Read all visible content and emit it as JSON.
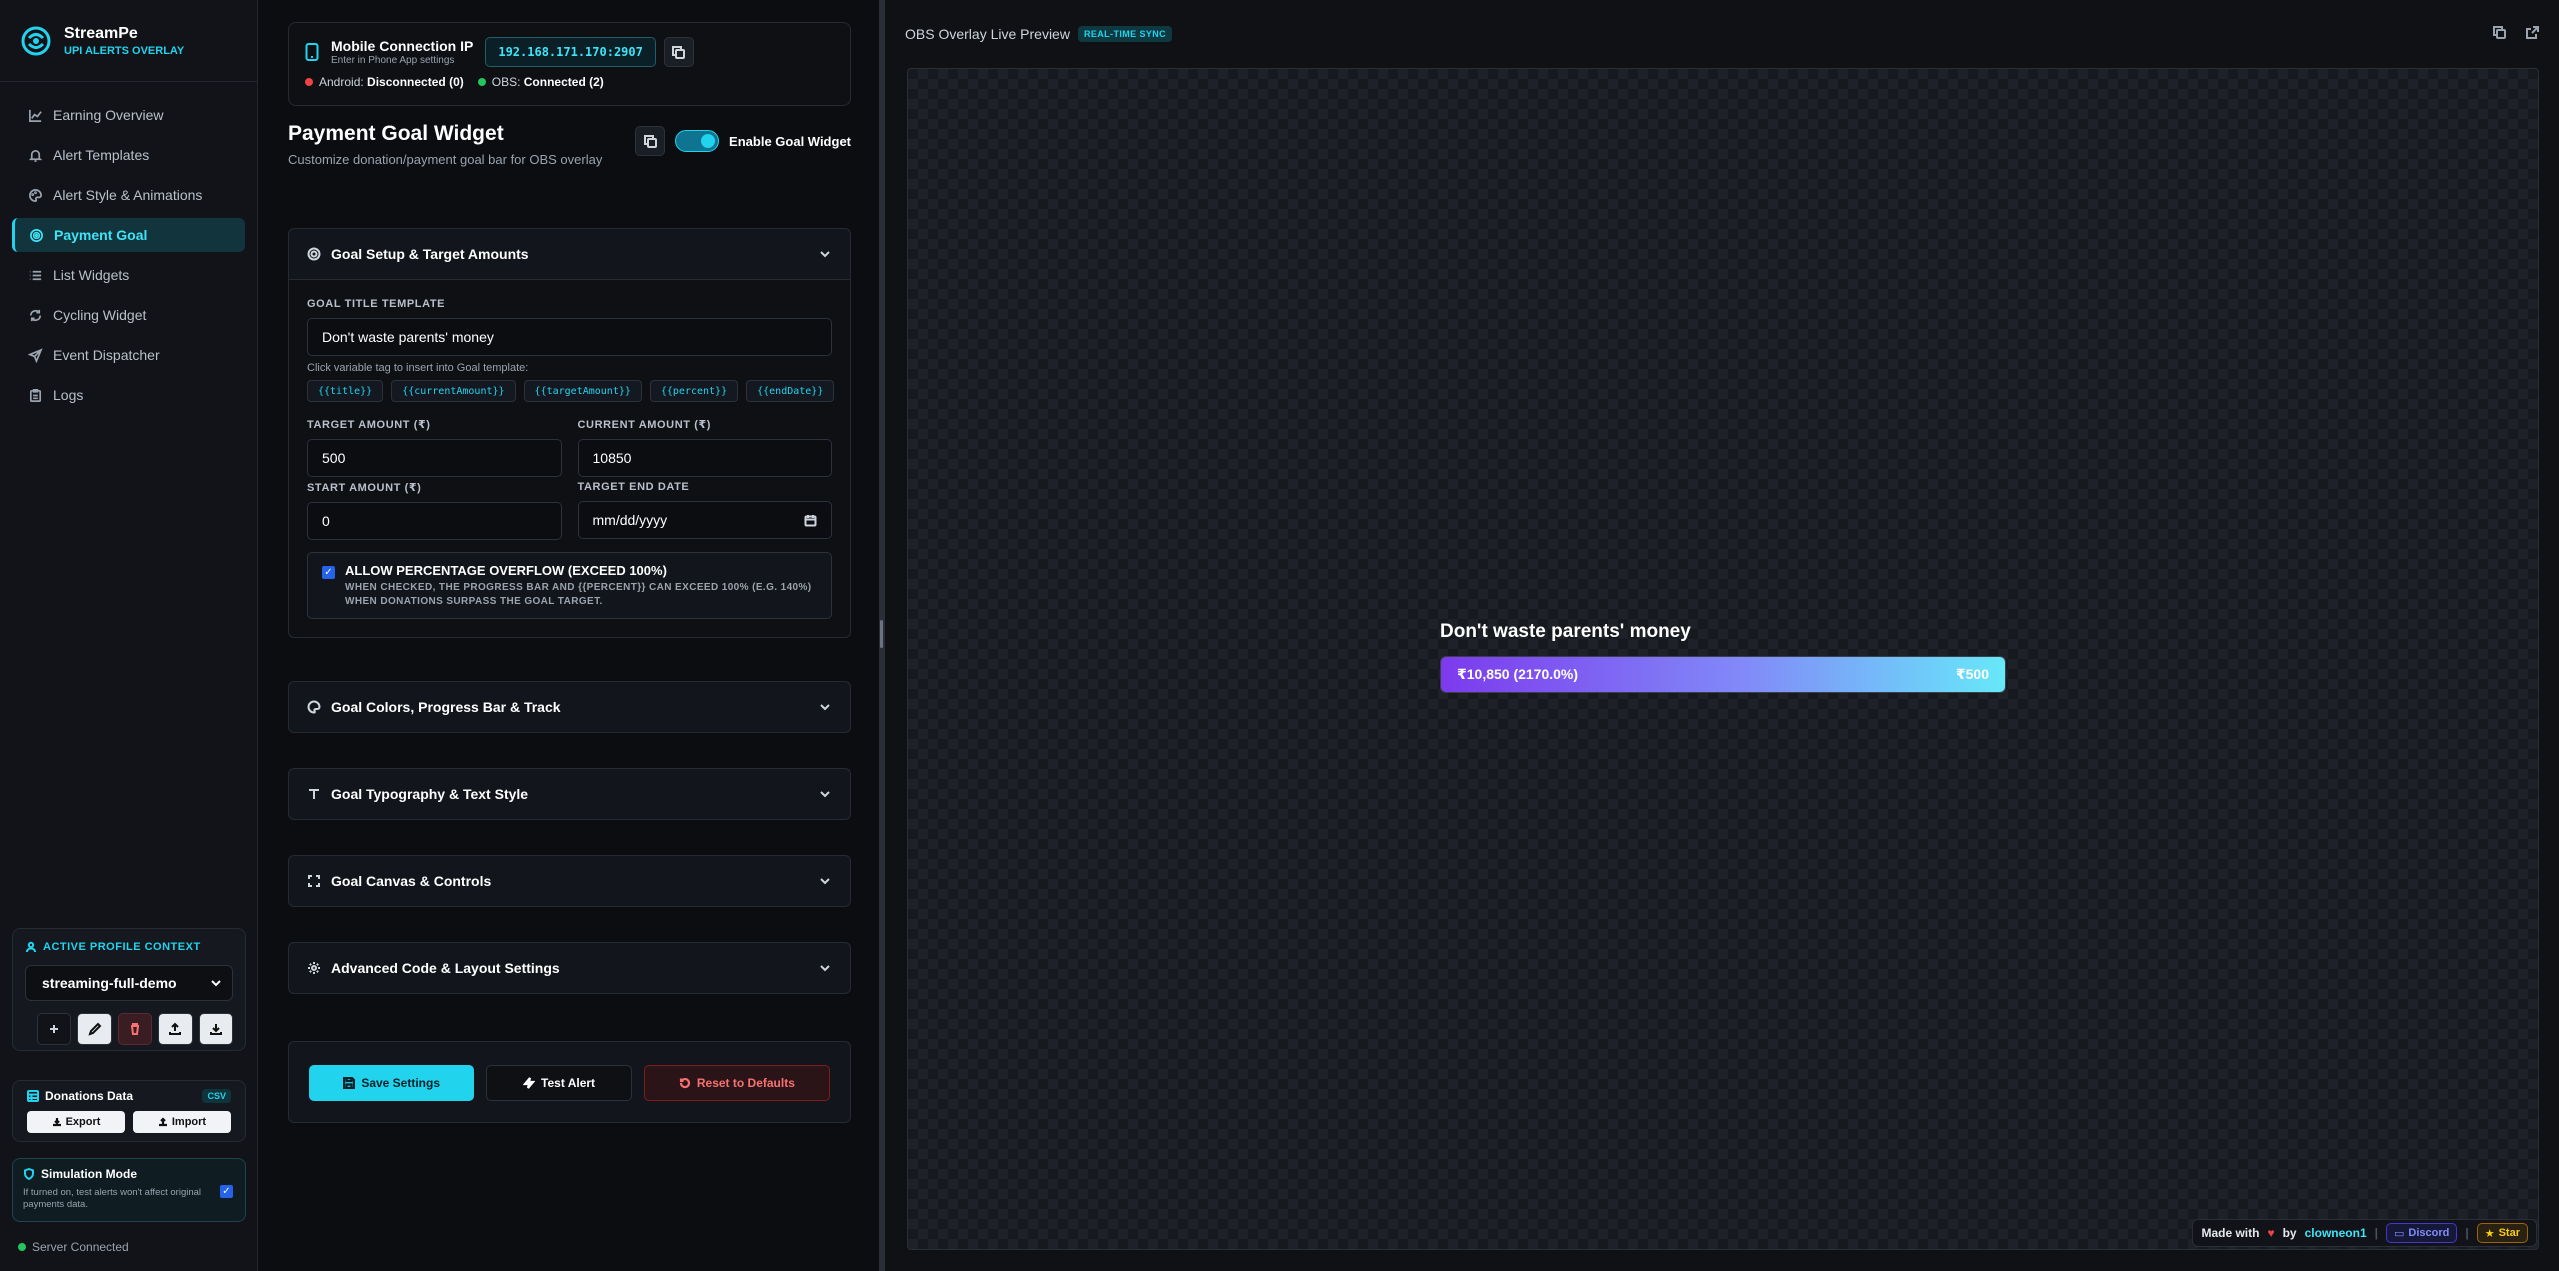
{
  "brand": {
    "name": "StreamPe",
    "subtitle": "UPI ALERTS OVERLAY"
  },
  "sidebar": {
    "items": [
      {
        "label": "Earning Overview",
        "icon": "chart-line-icon"
      },
      {
        "label": "Alert Templates",
        "icon": "bell-icon"
      },
      {
        "label": "Alert Style & Animations",
        "icon": "palette-icon"
      },
      {
        "label": "Payment Goal",
        "icon": "target-icon",
        "active": true
      },
      {
        "label": "List Widgets",
        "icon": "list-icon"
      },
      {
        "label": "Cycling Widget",
        "icon": "cycle-icon"
      },
      {
        "label": "Event Dispatcher",
        "icon": "send-icon"
      },
      {
        "label": "Logs",
        "icon": "clipboard-icon"
      }
    ],
    "profile": {
      "heading": "ACTIVE PROFILE CONTEXT",
      "selected": "streaming-full-demo"
    },
    "donations": {
      "title": "Donations Data",
      "badge": "CSV",
      "export_label": "Export",
      "import_label": "Import"
    },
    "simulation": {
      "title": "Simulation Mode",
      "description": "If turned on, test alerts won't affect original payments data.",
      "checked": true
    },
    "server_status": "Server Connected"
  },
  "connection": {
    "title": "Mobile Connection IP",
    "subtitle": "Enter in Phone App settings",
    "ip": "192.168.171.170:2907",
    "android_label": "Android:",
    "android_status": "Disconnected (0)",
    "obs_label": "OBS:",
    "obs_status": "Connected (2)"
  },
  "widget": {
    "title": "Payment Goal Widget",
    "subtitle": "Customize donation/payment goal bar for OBS overlay",
    "enable_label": "Enable Goal Widget",
    "enabled": true
  },
  "goal_setup": {
    "heading": "Goal Setup & Target Amounts",
    "title_template_label": "GOAL TITLE TEMPLATE",
    "title_template_value": "Don't waste parents' money",
    "tags_hint": "Click variable tag to insert into Goal template:",
    "tags": [
      "{{title}}",
      "{{currentAmount}}",
      "{{targetAmount}}",
      "{{percent}}",
      "{{endDate}}"
    ],
    "target_label": "TARGET AMOUNT (₹)",
    "target_value": "500",
    "current_label": "CURRENT AMOUNT (₹)",
    "current_value": "10850",
    "start_label": "START AMOUNT (₹)",
    "start_value": "0",
    "end_date_label": "TARGET END DATE",
    "end_date_placeholder": "mm/dd/yyyy",
    "overflow_title": "ALLOW PERCENTAGE OVERFLOW (EXCEED 100%)",
    "overflow_desc": "WHEN CHECKED, THE PROGRESS BAR AND {{PERCENT}} CAN EXCEED 100% (E.G. 140%) WHEN DONATIONS SURPASS THE GOAL TARGET.",
    "overflow_checked": true
  },
  "sections": {
    "colors": "Goal Colors, Progress Bar & Track",
    "typography": "Goal Typography & Text Style",
    "canvas": "Goal Canvas & Controls",
    "advanced": "Advanced Code & Layout Settings"
  },
  "actions": {
    "save": "Save Settings",
    "test": "Test Alert",
    "reset": "Reset to Defaults"
  },
  "preview": {
    "title": "OBS Overlay Live Preview",
    "badge": "REAL-TIME SYNC",
    "goal_title": "Don't waste parents' money",
    "current_text": "₹10,850 (2170.0%)",
    "target_text": "₹500",
    "progress_percent": 100
  },
  "footer": {
    "made_with": "Made with",
    "by": "by",
    "author": "clowneon1",
    "discord": "Discord",
    "star": "Star"
  },
  "colors": {
    "accent": "#22d3ee",
    "danger": "#f87171",
    "success": "#22c55e"
  }
}
